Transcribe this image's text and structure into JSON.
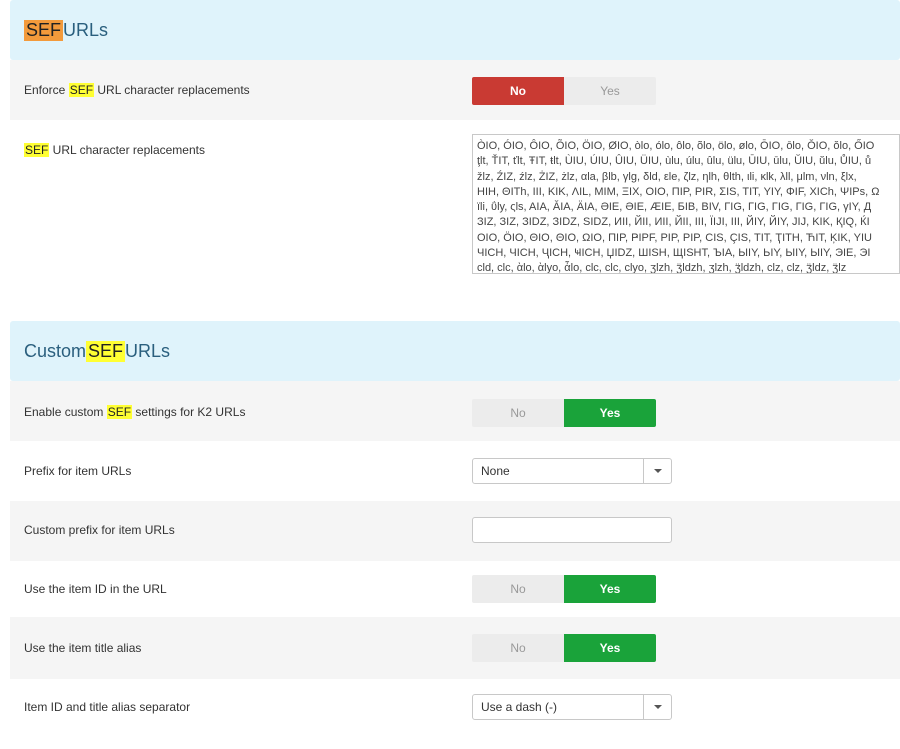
{
  "sef_section": {
    "title_highlight": "SEF",
    "title_rest": " URLs"
  },
  "enforce_replacements": {
    "label_pre": "Enforce ",
    "label_hl": "SEF",
    "label_post": " URL character replacements",
    "no_label": "No",
    "yes_label": "Yes",
    "selected": "No"
  },
  "replacements": {
    "label_hl": "SEF",
    "label_post": " URL character replacements",
    "lines": [
      "ÒIO, ÓIO, ÔIO, ÕIO, ÖIO, ØIO, òlo, ólo, ôlo, õlo, ölo, ølo, ŌIO, ōlo, ŎIO, ŏlo, ŐIO",
      "ţlt, ŤIT, ťlt, ŦIT, ŧlt, ÙIU, ÚIU, ÛIU, ÜIU, ùlu, úlu, ûlu, ülu, ŪIU, ūlu, ŬIU, ŭlu, ŮIU, ů",
      "žlz, ŹIZ, źlz, ŻIZ, żlz, αla, βlb, γlg, δld, εle, ζlz, ηlh, θlth, ιli, κlk, λll, μlm, νln, ξlx,",
      "HIH, ΘITh, III, KIK, ΛIL, MIM, ΞIX, OIO, ΠIP, PIR, ΣIS, TIT, YIY, ΦIF, XICh, ΨIPs, Ω",
      "ïli, ΰly, ςls, AIA, ĂIA, ÄIA, ƏIE, ƏIE, ÆIE, БIB, BIV, ΓIG, ΓIG, ΓIG, ΓIG, ΓIG, γIY, Д",
      "ЗIZ, ЗIZ, ЗIDZ, ЗIDZ, SIDZ, ИII, ЙII, ИII, ЙII, III, ЇIJI, III, ЙIY, ЙIY, JIJ, KIK, ҚIQ, ЌI",
      "OIO, ÖIO, ΘIO, ΘIO, ΩIO, ΠIP, ҎIPF, PIP, PIP, CIS, ÇIS, TIT, ҬITH, ЋIT, ĶIK, YIU",
      "ЧICH, ЧICH, ҶICH, ҸICH, ЏIDZ, ШISH, ЩISHT, ЪIA, ЫIY, ЬIY, ЫIY, ЫIY, ЭIE, ЭI",
      "cld, clc, ὰlo, ὰlyo, ἆlo, clc, clc, clyo, ʒlzh, ʒ̈ldzh, ʒlzh, ʒ̈ldzh, clz, clz, ʒ̈ldz, ʒ̈lz"
    ]
  },
  "custom_section": {
    "title_pre": "Custom ",
    "title_highlight": "SEF",
    "title_rest": " URLs"
  },
  "enable_custom": {
    "label_pre": "Enable custom ",
    "label_hl": "SEF",
    "label_post": " settings for K2 URLs",
    "no_label": "No",
    "yes_label": "Yes",
    "selected": "Yes"
  },
  "item_prefix": {
    "label": "Prefix for item URLs",
    "value": "None"
  },
  "custom_prefix": {
    "label": "Custom prefix for item URLs",
    "value": ""
  },
  "use_item_id": {
    "label": "Use the item ID in the URL",
    "no_label": "No",
    "yes_label": "Yes",
    "selected": "Yes"
  },
  "use_title_alias": {
    "label": "Use the item title alias",
    "no_label": "No",
    "yes_label": "Yes",
    "selected": "Yes"
  },
  "separator": {
    "label": "Item ID and title alias separator",
    "value": "Use a dash (-)"
  },
  "colors": {
    "header_bg": "#dff3fb",
    "header_text": "#2a5f7e",
    "no_active": "#c93a33",
    "yes_active": "#1aa33a",
    "highlight_orange": "#f39a3b",
    "highlight_yellow": "#ffff33"
  }
}
